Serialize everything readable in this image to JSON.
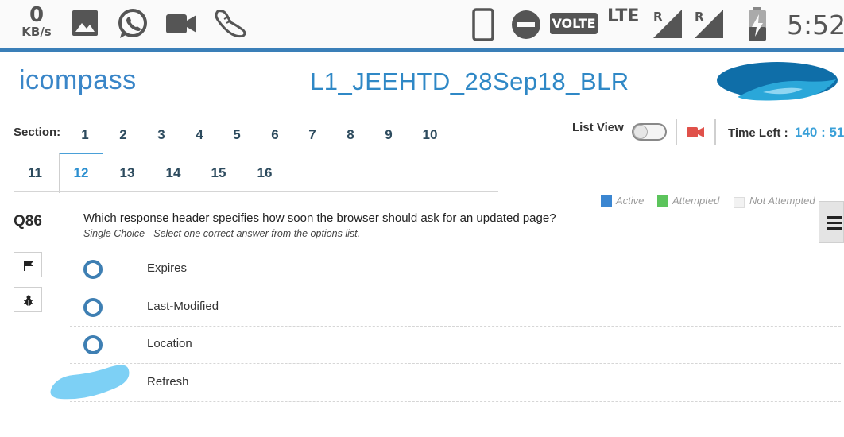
{
  "status_bar": {
    "speed_value": "0",
    "speed_unit": "KB/s",
    "volte": "VOLTE",
    "lte": "LTE",
    "roaming_1": "R",
    "roaming_2": "R",
    "time": "5:52",
    "icons": [
      "image-icon",
      "whatsapp-icon",
      "video-icon",
      "shoe-icon",
      "phone-icon",
      "do-not-disturb-icon",
      "signal-icon",
      "battery-charging-icon"
    ]
  },
  "header": {
    "logo_text": "icompass",
    "test_title": "L1_JEEHTD_28Sep18_BLR"
  },
  "sections": {
    "label": "Section:",
    "row1": [
      "1",
      "2",
      "3",
      "4",
      "5",
      "6",
      "7",
      "8",
      "9",
      "10"
    ],
    "row2": [
      "11",
      "12",
      "13",
      "14",
      "15",
      "16"
    ],
    "active": "12"
  },
  "controls": {
    "list_view_label": "List View",
    "list_view_on": false,
    "time_left_label": "Time Left :",
    "time_left_value": "140 : 51"
  },
  "legend": {
    "active": "Active",
    "attempted": "Attempted",
    "not_attempted": "Not Attempted",
    "colors": {
      "active": "#3b86d1",
      "attempted": "#5cc45c",
      "not_attempted": "#f2f2f2"
    }
  },
  "question": {
    "number": "Q86",
    "text": "Which response header specifies how soon the browser should ask for an updated page?",
    "hint": "Single Choice - Select one correct answer from the options list.",
    "options": [
      "Expires",
      "Last-Modified",
      "Location",
      "Refresh"
    ]
  },
  "colors": {
    "accent": "#2f88c6",
    "statusbar_line": "#3a7fb8",
    "radio": "#3e7fb3",
    "redaction": "#7dd0f5"
  }
}
